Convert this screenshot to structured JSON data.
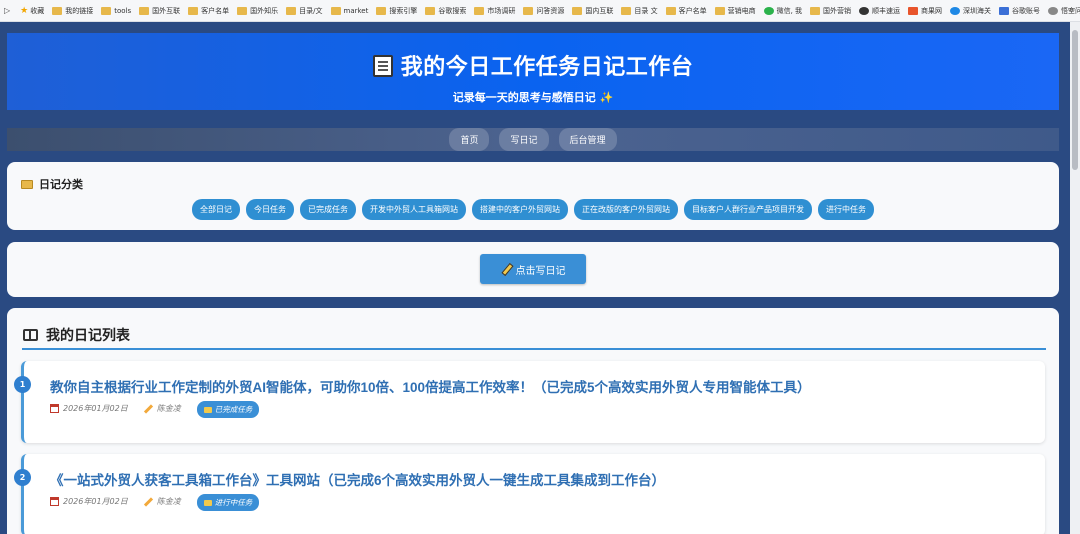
{
  "bookmarks": {
    "items": [
      "收藏",
      "我的链接",
      "tools",
      "国外互联",
      "客户名单",
      "国外知乐",
      "目录/文",
      "market",
      "搜索引擎",
      "谷歌搜索",
      "市场调研",
      "问答资源",
      "国内互联",
      "目录 文",
      "客户名单",
      "营销电商",
      "微信, 我",
      "国外营销",
      "顺丰速运",
      "商果网",
      "深圳海关",
      "谷歌账号",
      "悟空问答"
    ],
    "more": "»"
  },
  "header": {
    "title": "我的今日工作任务日记工作台",
    "subtitle": "记录每一天的思考与感悟日记 ✨"
  },
  "nav": {
    "items": [
      "首页",
      "写日记",
      "后台管理"
    ]
  },
  "categories": {
    "title": "日记分类",
    "items": [
      "全部日记",
      "今日任务",
      "已完成任务",
      "开发中外贸人工具箱网站",
      "搭建中的客户外贸网站",
      "正在改版的客户外贸网站",
      "目标客户人群行业产品项目开发",
      "进行中任务"
    ]
  },
  "write": {
    "button_label": "点击写日记"
  },
  "diary_list": {
    "title": "我的日记列表",
    "entries": [
      {
        "num": "1",
        "title": "教你自主根据行业工作定制的外贸AI智能体，可助你10倍、100倍提高工作效率！（已完成5个高效实用外贸人专用智能体工具）",
        "date": "2026年01月02日",
        "author": "陈金凌",
        "category": "已完成任务"
      },
      {
        "num": "2",
        "title": "《一站式外贸人获客工具箱工作台》工具网站（已完成6个高效实用外贸人一键生成工具集成到工作台）",
        "date": "2026年01月02日",
        "author": "陈金凌",
        "category": "进行中任务"
      }
    ]
  }
}
